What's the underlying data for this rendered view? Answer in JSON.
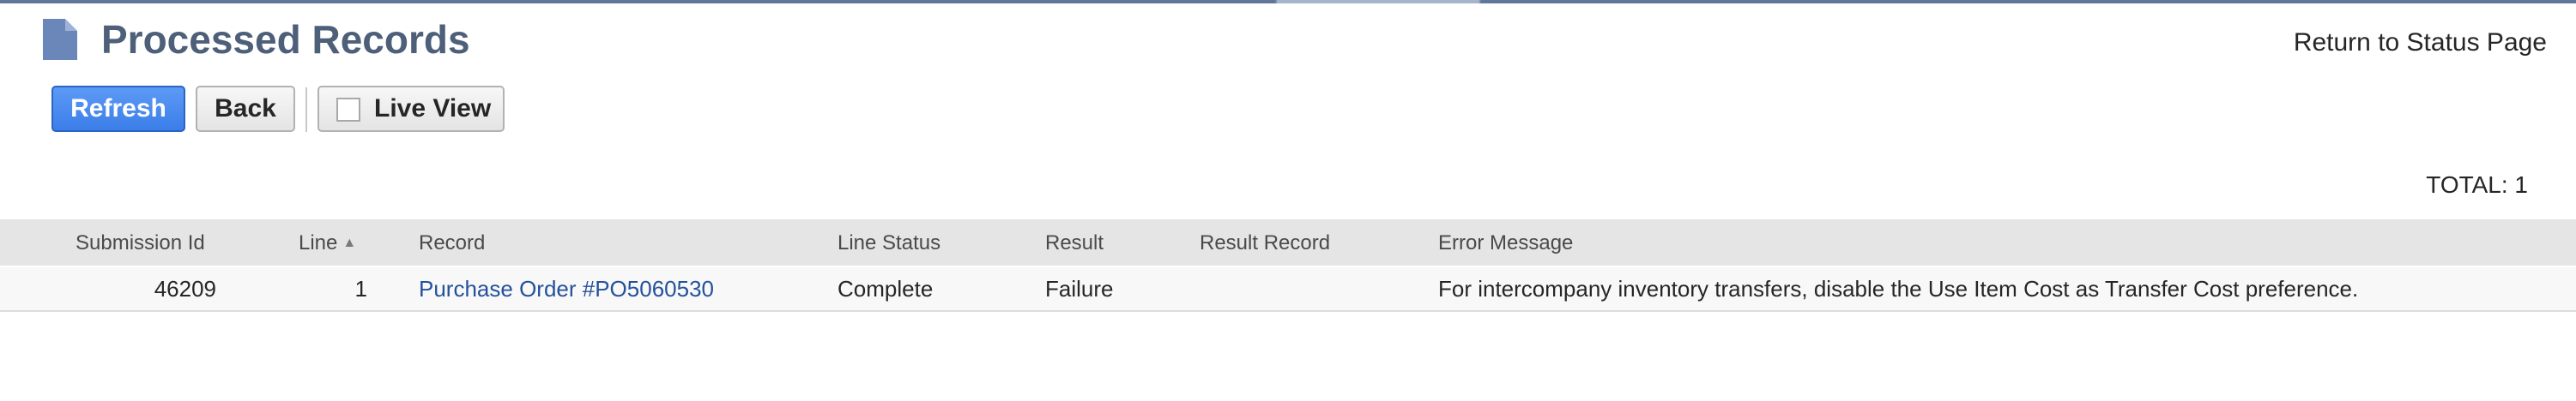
{
  "page": {
    "title": "Processed Records",
    "return_link": "Return to Status Page"
  },
  "toolbar": {
    "refresh_label": "Refresh",
    "back_label": "Back",
    "live_view_label": "Live View",
    "live_view_checked": false
  },
  "total_label": "TOTAL: 1",
  "table": {
    "columns": [
      "Submission Id",
      "Line",
      "Record",
      "Line Status",
      "Result",
      "Result Record",
      "Error Message"
    ],
    "sorted_column": "Line",
    "sort_direction": "ascending",
    "rows": [
      {
        "submission_id": "46209",
        "line": "1",
        "record": "Purchase Order #PO5060530",
        "line_status": "Complete",
        "result": "Failure",
        "result_record": "",
        "error_message": "For intercompany inventory transfers, disable the Use Item Cost as Transfer Cost preference."
      }
    ]
  },
  "colors": {
    "title": "#4d5f79",
    "primary_button": "#3b7ee8",
    "link": "#24519c",
    "header_bg": "#e5e5e5"
  },
  "icons": {
    "page_icon": "document-icon",
    "sort_icon": "sort-ascending-icon"
  }
}
